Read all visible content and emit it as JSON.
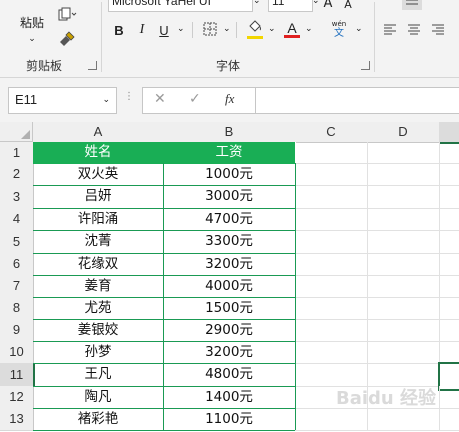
{
  "ribbon": {
    "paste_label": "粘贴",
    "font_name": "Microsoft YaHei UI",
    "font_size": "11",
    "bold": "B",
    "italic": "I",
    "underline": "U",
    "grow_font": "A",
    "shrink_font": "A",
    "font_color_glyph": "A",
    "phonetic_top": "wén",
    "phonetic_bottom": "文",
    "clipboard_group": "剪贴板",
    "font_group": "字体",
    "fill_color": "#f2d600",
    "font_color": "#e02020"
  },
  "formula_bar": {
    "name_box": "E11",
    "cancel": "✕",
    "enter": "✓",
    "fx": "fx",
    "formula": ""
  },
  "columns": [
    "A",
    "B",
    "C",
    "D"
  ],
  "rows": [
    "1",
    "2",
    "3",
    "4",
    "5",
    "6",
    "7",
    "8",
    "9",
    "10",
    "11",
    "12",
    "13"
  ],
  "table": {
    "headers": [
      "姓名",
      "工资"
    ],
    "rows": [
      [
        "双火英",
        "1000元"
      ],
      [
        "吕妍",
        "3000元"
      ],
      [
        "许阳涌",
        "4700元"
      ],
      [
        "沈菁",
        "3300元"
      ],
      [
        "花缘双",
        "3200元"
      ],
      [
        "姜育",
        "4000元"
      ],
      [
        "尤苑",
        "1500元"
      ],
      [
        "姜银姣",
        "2900元"
      ],
      [
        "孙梦",
        "3200元"
      ],
      [
        "王凡",
        "4800元"
      ],
      [
        "陶凡",
        "1400元"
      ],
      [
        "褚彩艳",
        "1100元"
      ]
    ],
    "header_color": "#19ae55"
  },
  "selection": {
    "cell": "E11"
  },
  "watermark": "Baidu 经验"
}
